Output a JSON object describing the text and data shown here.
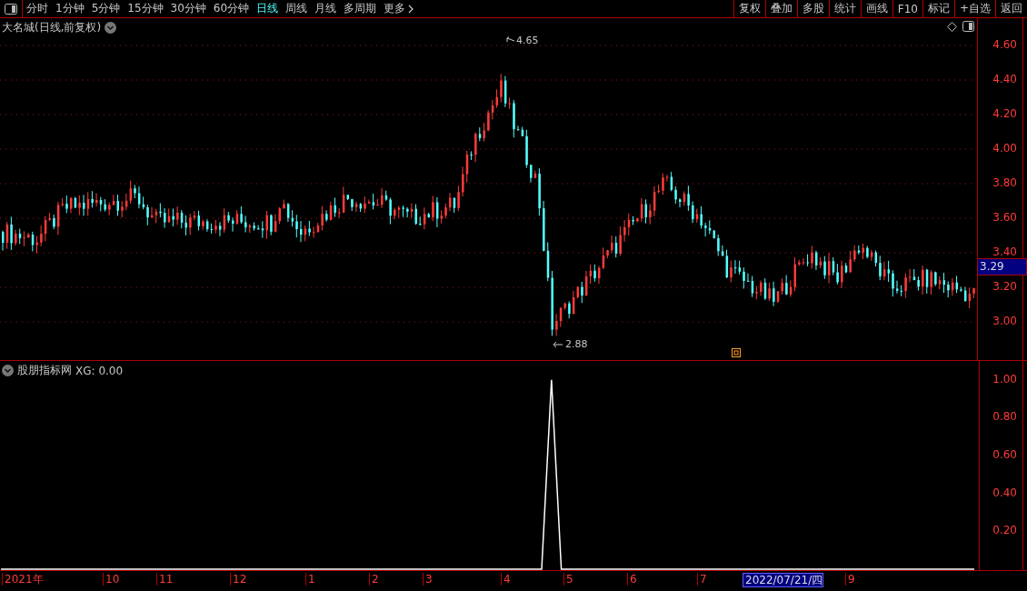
{
  "toolbar": {
    "periods": [
      {
        "label": "分时",
        "selected": false
      },
      {
        "label": "1分钟",
        "selected": false
      },
      {
        "label": "5分钟",
        "selected": false
      },
      {
        "label": "15分钟",
        "selected": false
      },
      {
        "label": "30分钟",
        "selected": false
      },
      {
        "label": "60分钟",
        "selected": false
      },
      {
        "label": "日线",
        "selected": true
      },
      {
        "label": "周线",
        "selected": false
      },
      {
        "label": "月线",
        "selected": false
      },
      {
        "label": "多周期",
        "selected": false
      }
    ],
    "more": "更多",
    "buttons": [
      "复权",
      "叠加",
      "多股",
      "统计",
      "画线",
      "F10",
      "标记",
      "+自选",
      "返回"
    ]
  },
  "main_chart": {
    "title": "大名城(日线,前复权)",
    "price_ticks": [
      "4.60",
      "4.40",
      "4.20",
      "4.00",
      "3.80",
      "3.60",
      "3.40",
      "3.20",
      "3.00"
    ],
    "high_label": "4.65",
    "low_label": "2.88",
    "last_price": "3.29"
  },
  "indicator": {
    "title": "股朋指标网",
    "reading": "XG: 0.00",
    "chart_data": {
      "type": "line",
      "categories": [
        null,
        null,
        null,
        null,
        null,
        null,
        null,
        null,
        null,
        null,
        null,
        null,
        null,
        null,
        null,
        null,
        null,
        null,
        null,
        null,
        null,
        null,
        null,
        null,
        null,
        null,
        null,
        null,
        null,
        null,
        null,
        null,
        null,
        null,
        null,
        null,
        null,
        null,
        null,
        null,
        null,
        null,
        null,
        null,
        null,
        null,
        null,
        null,
        null,
        null,
        null,
        null,
        null,
        null,
        null,
        null,
        null,
        null,
        null,
        null,
        null,
        null,
        null,
        null,
        null,
        null,
        null,
        null,
        null,
        null,
        null,
        null,
        null,
        null,
        null,
        null,
        null,
        null,
        null,
        null,
        null,
        null,
        null,
        null,
        null,
        null,
        null,
        null,
        null,
        null,
        null,
        null,
        null,
        null,
        null,
        null,
        null,
        null,
        null,
        null
      ],
      "series": [
        {
          "color": "#ffffff",
          "values": [
            0,
            0,
            0,
            0,
            0,
            0,
            0,
            0,
            0,
            0,
            0,
            0,
            0,
            0,
            0,
            0,
            0,
            0,
            0,
            0,
            0,
            0,
            0,
            0,
            0,
            0,
            0,
            0,
            0,
            0,
            0,
            0,
            0,
            0,
            0,
            0,
            0,
            0,
            0,
            0,
            0,
            0,
            0,
            0,
            0,
            0,
            0,
            0,
            0,
            0,
            0,
            0,
            0,
            0,
            0,
            0,
            1,
            0,
            0,
            0,
            0,
            0,
            0,
            0,
            0,
            0,
            0,
            0,
            0,
            0,
            0,
            0,
            0,
            0,
            0,
            0,
            0,
            0,
            0,
            0,
            0,
            0,
            0,
            0,
            0,
            0,
            0,
            0,
            0,
            0,
            0,
            0,
            0,
            0,
            0,
            0,
            0,
            0,
            0,
            0
          ]
        }
      ],
      "ylim": [
        0,
        1.1
      ],
      "yticks": [
        {
          "value": 1,
          "label": "1.00"
        },
        {
          "value": 0.8,
          "label": "0.80"
        },
        {
          "value": 0.6,
          "label": "0.60"
        },
        {
          "value": 0.4,
          "label": "0.40"
        },
        {
          "value": 0.2,
          "label": "0.20"
        }
      ]
    }
  },
  "time_axis": {
    "labels": [
      {
        "text": "2021年",
        "selected": false
      },
      {
        "text": "10",
        "selected": false
      },
      {
        "text": "11",
        "selected": false
      },
      {
        "text": "12",
        "selected": false
      },
      {
        "text": "1",
        "selected": false
      },
      {
        "text": "2",
        "selected": false
      },
      {
        "text": "3",
        "selected": false
      },
      {
        "text": "4",
        "selected": false
      },
      {
        "text": "5",
        "selected": false
      },
      {
        "text": "6",
        "selected": false
      },
      {
        "text": "7",
        "selected": false
      },
      {
        "text": "2022/07/21/四",
        "selected": true
      },
      {
        "text": "9",
        "selected": false
      }
    ]
  }
}
